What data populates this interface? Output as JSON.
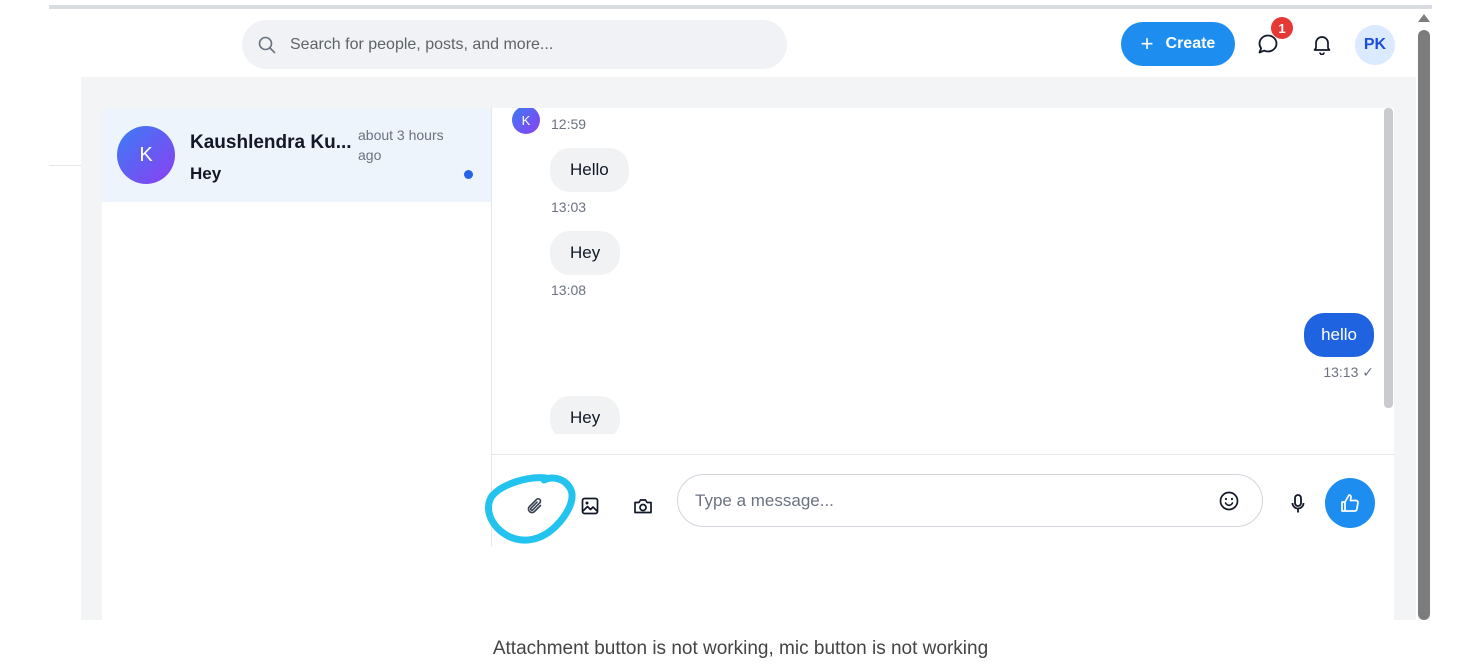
{
  "header": {
    "search_placeholder": "Search for people, posts, and more...",
    "create_label": "Create",
    "create_plus": "+",
    "chat_badge": "1",
    "user_initials": "PK"
  },
  "conversation": {
    "avatar_letter": "K",
    "name": "Kaushlendra Ku...",
    "time": "about 3 hours ago",
    "preview": "Hey"
  },
  "messages": {
    "sender_avatar": "K",
    "items": [
      {
        "text": "",
        "time": "12:59",
        "dir": "in"
      },
      {
        "text": "Hello",
        "time": "13:03",
        "dir": "in"
      },
      {
        "text": "Hey",
        "time": "13:08",
        "dir": "in"
      },
      {
        "text": "hello",
        "time": "13:13 ✓",
        "dir": "out"
      },
      {
        "text": "Hey",
        "time": "",
        "dir": "in"
      }
    ]
  },
  "composer": {
    "placeholder": "Type a message..."
  },
  "caption": "Attachment button is not working, mic button is not working",
  "colors": {
    "primary": "#1d8ef0",
    "outgoing_bubble": "#1f63e0",
    "badge": "#e53935",
    "annotation": "#22c3ee"
  },
  "icons": [
    "search-icon",
    "plus-icon",
    "chat-icon",
    "bell-icon",
    "paperclip-icon",
    "image-icon",
    "camera-icon",
    "emoji-icon",
    "mic-icon",
    "thumbs-up-icon"
  ]
}
